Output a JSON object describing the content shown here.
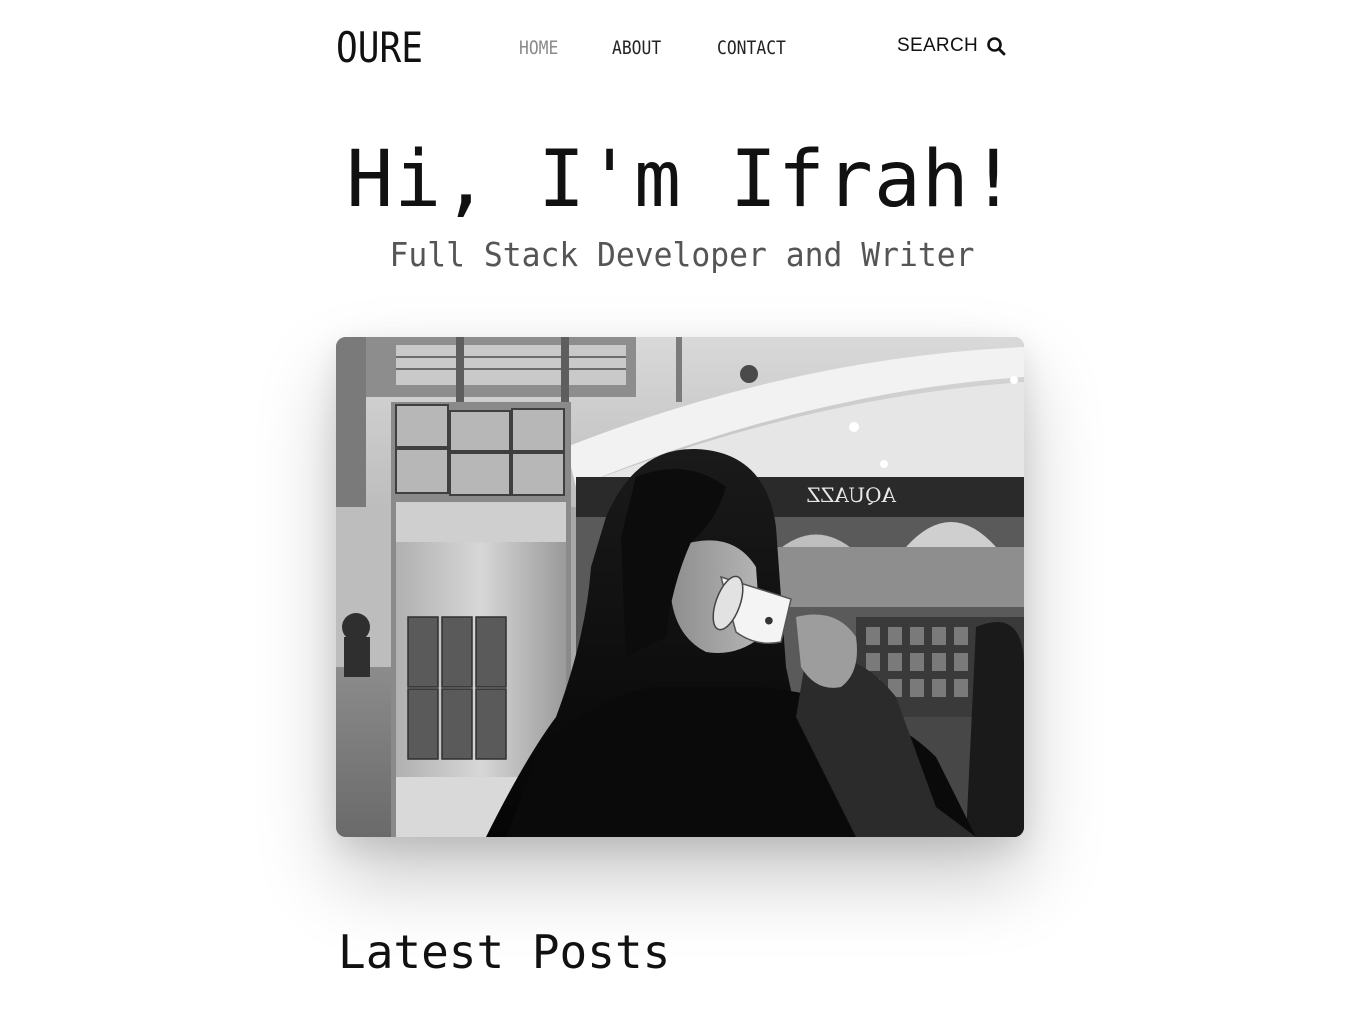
{
  "header": {
    "logo": "OURE",
    "nav": [
      {
        "label": "HOME",
        "active": true
      },
      {
        "label": "ABOUT",
        "active": false
      },
      {
        "label": "CONTACT",
        "active": false
      }
    ],
    "search": {
      "label": "SEARCH",
      "icon": "search-icon"
    }
  },
  "hero": {
    "title": "Hi, I'm Ifrah!",
    "subtitle": "Full Stack Developer and Writer"
  },
  "photo": {
    "style": "grayscale",
    "sign_text": "AQUAZZ"
  },
  "latest_posts": {
    "title": "Latest Posts"
  },
  "colors": {
    "text": "#111111",
    "nav_active": "#8a8a8a",
    "subtitle": "#555555",
    "background": "#ffffff"
  }
}
